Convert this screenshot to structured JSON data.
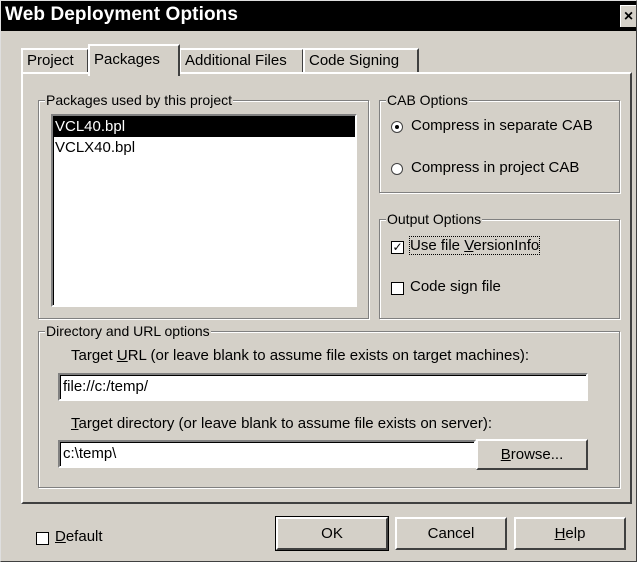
{
  "window": {
    "title": "Web Deployment Options",
    "close_glyph": "×"
  },
  "tabs": [
    {
      "label": "Project",
      "active": false
    },
    {
      "label": "Packages",
      "active": true
    },
    {
      "label": "Additional Files",
      "active": false
    },
    {
      "label": "Code Signing",
      "active": false
    }
  ],
  "packages": {
    "label": "Packages used by this project",
    "items": [
      "VCL40.bpl",
      "VCLX40.bpl"
    ],
    "selected_index": 0
  },
  "cab_options": {
    "label": "CAB Options",
    "separate_label": "Compress in separate CAB",
    "project_label": "Compress in project CAB",
    "selected": "separate"
  },
  "output_options": {
    "label": "Output Options",
    "version_pre": "Use file ",
    "version_key": "V",
    "version_post": "ersionInfo",
    "version_checked": true,
    "codesign_label": "Code sign file",
    "codesign_checked": false,
    "check_glyph": "✓"
  },
  "directory": {
    "label": "Directory and URL options",
    "url_pre": "Target ",
    "url_key": "U",
    "url_post": "RL (or leave blank to assume file exists on target machines):",
    "url_value": "file://c:/temp/",
    "dir_key": "T",
    "dir_post": "arget directory (or leave blank to assume file exists on server):",
    "dir_value": "c:\\temp\\",
    "browse_key": "B",
    "browse_post": "rowse..."
  },
  "footer": {
    "default_key": "D",
    "default_post": "efault",
    "default_checked": false,
    "ok_label": "OK",
    "cancel_label": "Cancel",
    "help_key": "H",
    "help_post": "elp"
  }
}
